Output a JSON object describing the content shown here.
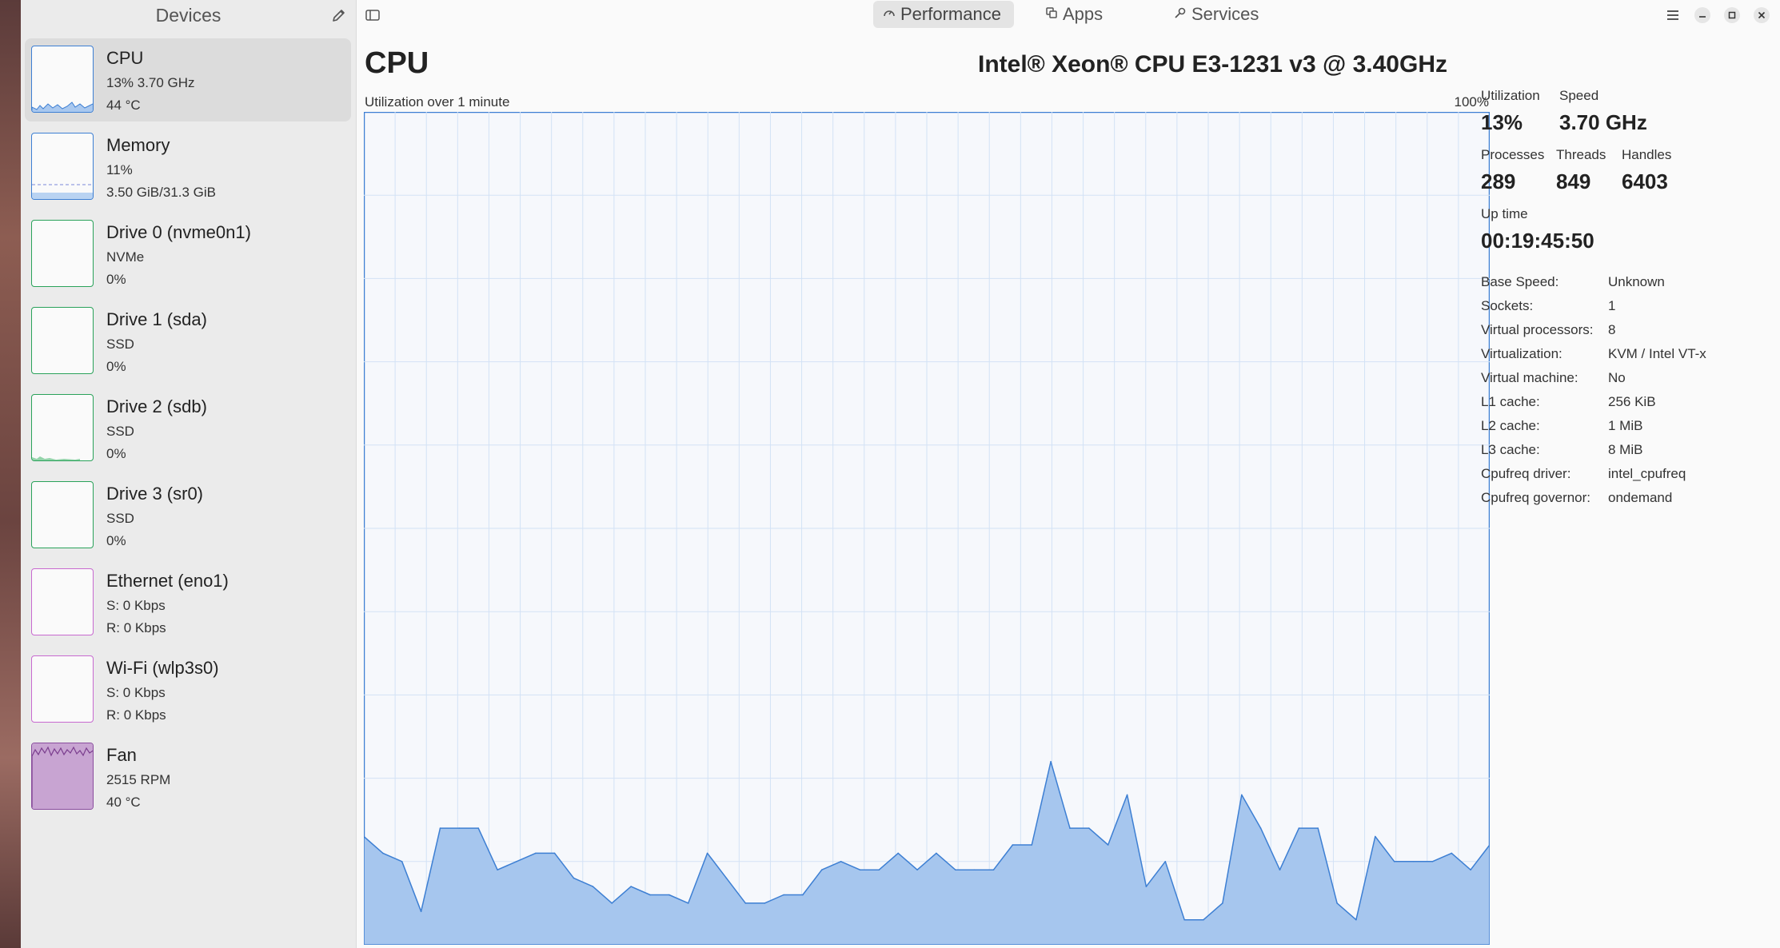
{
  "sidebar": {
    "title": "Devices",
    "devices": [
      {
        "name": "CPU",
        "line1": "13% 3.70 GHz",
        "line2": "44 °C",
        "color": "#3d7fd3",
        "selected": true
      },
      {
        "name": "Memory",
        "line1": "11%",
        "line2": "3.50 GiB/31.3 GiB",
        "color": "#3d7fd3"
      },
      {
        "name": "Drive 0 (nvme0n1)",
        "line1": "NVMe",
        "line2": "0%",
        "color": "#2aa25a"
      },
      {
        "name": "Drive 1 (sda)",
        "line1": "SSD",
        "line2": "0%",
        "color": "#2aa25a"
      },
      {
        "name": "Drive 2 (sdb)",
        "line1": "SSD",
        "line2": "0%",
        "color": "#2aa25a"
      },
      {
        "name": "Drive 3 (sr0)",
        "line1": "SSD",
        "line2": "0%",
        "color": "#2aa25a"
      },
      {
        "name": "Ethernet (eno1)",
        "line1": "S: 0 Kbps",
        "line2": "R: 0 Kbps",
        "color": "#c86ad0"
      },
      {
        "name": "Wi-Fi (wlp3s0)",
        "line1": "S: 0 Kbps",
        "line2": "R: 0 Kbps",
        "color": "#c86ad0"
      },
      {
        "name": "Fan",
        "line1": "2515 RPM",
        "line2": "40 °C",
        "color": "#8a4d9e"
      }
    ]
  },
  "header": {
    "tabs": [
      {
        "label": "Performance",
        "icon": "gauge-icon",
        "active": true
      },
      {
        "label": "Apps",
        "icon": "apps-icon"
      },
      {
        "label": "Services",
        "icon": "gear-icon"
      }
    ]
  },
  "main": {
    "title": "CPU",
    "model": "Intel® Xeon® CPU E3-1231 v3 @ 3.40GHz",
    "graph_caption": "Utilization over 1 minute",
    "graph_max": "100%"
  },
  "stats": {
    "utilization_label": "Utilization",
    "utilization": "13%",
    "speed_label": "Speed",
    "speed": "3.70 GHz",
    "processes_label": "Processes",
    "processes": "289",
    "threads_label": "Threads",
    "threads": "849",
    "handles_label": "Handles",
    "handles": "6403",
    "uptime_label": "Up time",
    "uptime": "00:19:45:50",
    "details": [
      {
        "key": "Base Speed:",
        "value": "Unknown"
      },
      {
        "key": "Sockets:",
        "value": "1"
      },
      {
        "key": "Virtual processors:",
        "value": "8"
      },
      {
        "key": "Virtualization:",
        "value": "KVM / Intel VT-x"
      },
      {
        "key": "Virtual machine:",
        "value": "No"
      },
      {
        "key": "L1 cache:",
        "value": "256 KiB"
      },
      {
        "key": "L2 cache:",
        "value": "1 MiB"
      },
      {
        "key": "L3 cache:",
        "value": "8 MiB"
      },
      {
        "key": "Cpufreq driver:",
        "value": "intel_cpufreq"
      },
      {
        "key": "Cpufreq governor:",
        "value": "ondemand"
      }
    ]
  },
  "chart_data": {
    "type": "area",
    "title": "",
    "xlabel": "",
    "ylabel": "",
    "ylim": [
      0,
      100
    ],
    "grid": true,
    "series": [
      {
        "values": [
          13,
          11,
          10,
          4,
          14,
          14,
          14,
          9,
          10,
          11,
          11,
          8,
          7,
          5,
          7,
          6,
          6,
          5,
          11,
          8,
          5,
          5,
          6,
          6,
          9,
          10,
          9,
          9,
          11,
          9,
          11,
          9,
          9,
          9,
          12,
          12,
          22,
          14,
          14,
          12,
          18,
          7,
          10,
          3,
          3,
          5,
          18,
          14,
          9,
          14,
          14,
          5,
          3,
          13,
          10,
          10,
          10,
          11,
          9,
          12
        ]
      }
    ]
  }
}
